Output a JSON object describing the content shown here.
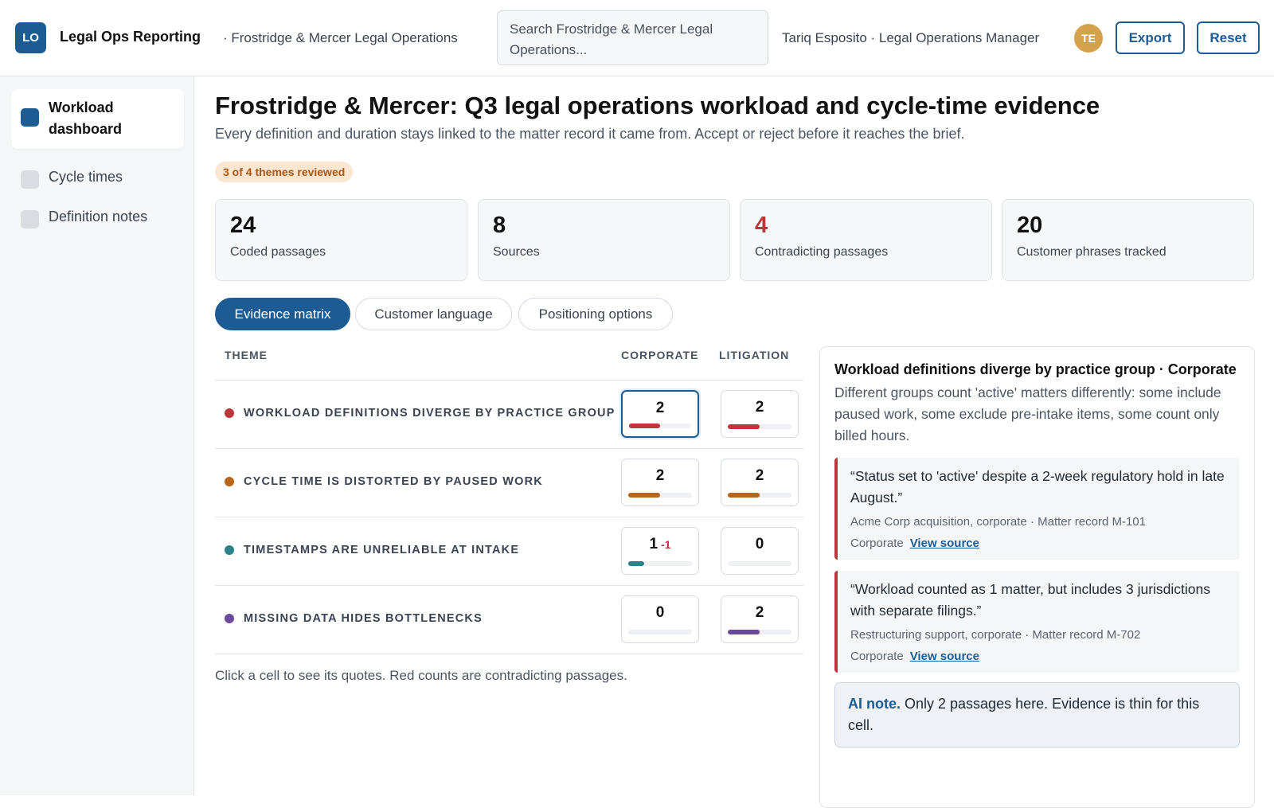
{
  "header": {
    "logo_text": "LO",
    "app_title": "Legal Ops Reporting",
    "org_name": "· Frostridge & Mercer Legal Operations",
    "search_placeholder": "Search Frostridge & Mercer Legal Operations...",
    "user": "Tariq Esposito · Legal Operations Manager",
    "avatar_initials": "TE",
    "export_label": "Export",
    "reset_label": "Reset"
  },
  "sidebar": {
    "items": [
      {
        "label": "Workload dashboard",
        "active": true
      },
      {
        "label": "Cycle times",
        "active": false
      },
      {
        "label": "Definition notes",
        "active": false
      }
    ]
  },
  "page": {
    "title": "Frostridge & Mercer: Q3 legal operations workload and cycle-time evidence",
    "subtitle": "Every definition and duration stays linked to the matter record it came from. Accept or reject before it reaches the brief.",
    "review_badge": "3 of 4 themes reviewed"
  },
  "stats": [
    {
      "value": "24",
      "label": "Coded passages"
    },
    {
      "value": "8",
      "label": "Sources"
    },
    {
      "value": "4",
      "label": "Contradicting passages",
      "highlight": "#c0343b"
    },
    {
      "value": "20",
      "label": "Customer phrases tracked"
    }
  ],
  "tabs": [
    {
      "label": "Evidence matrix",
      "active": true
    },
    {
      "label": "Customer language",
      "active": false
    },
    {
      "label": "Positioning options",
      "active": false
    }
  ],
  "matrix": {
    "headers": {
      "theme": "THEME",
      "corporate": "CORPORATE",
      "litigation": "LITIGATION"
    },
    "max_count": 4,
    "rows": [
      {
        "theme": "WORKLOAD DEFINITIONS DIVERGE BY PRACTICE GROUP",
        "color": "#c0343b",
        "corporate": {
          "count": "2",
          "delta": "",
          "level": 2,
          "selected": true
        },
        "litigation": {
          "count": "2",
          "delta": "",
          "level": 2
        }
      },
      {
        "theme": "CYCLE TIME IS DISTORTED BY PAUSED WORK",
        "color": "#b8651b",
        "corporate": {
          "count": "2",
          "delta": "",
          "level": 2
        },
        "litigation": {
          "count": "2",
          "delta": "",
          "level": 2
        }
      },
      {
        "theme": "TIMESTAMPS ARE UNRELIABLE AT INTAKE",
        "color": "#2a8289",
        "corporate": {
          "count": "1",
          "delta": "-1",
          "level": 1
        },
        "litigation": {
          "count": "0",
          "delta": "",
          "level": 0
        }
      },
      {
        "theme": "MISSING DATA HIDES BOTTLENECKS",
        "color": "#6b4a99",
        "corporate": {
          "count": "0",
          "delta": "",
          "level": 0
        },
        "litigation": {
          "count": "2",
          "delta": "",
          "level": 2
        }
      }
    ],
    "note": "Click a cell to see its quotes. Red counts are contradicting passages."
  },
  "panel": {
    "title": "Workload definitions diverge by practice group · Corporate",
    "description": "Different groups count 'active' matters differently: some include paused work, some exclude pre-intake items, some count only billed hours.",
    "quotes": [
      {
        "text": "“Status set to 'active' despite a 2-week regulatory hold in late August.”",
        "meta": "Acme Corp acquisition, corporate · Matter record M-101",
        "group": "Corporate",
        "link": "View source"
      },
      {
        "text": "“Workload counted as 1 matter, but includes 3 jurisdictions with separate filings.”",
        "meta": "Restructuring support, corporate · Matter record M-702",
        "group": "Corporate",
        "link": "View source"
      }
    ],
    "ai_note_label": "AI note.",
    "ai_note_text": " Only 2 passages here. Evidence is thin for this cell."
  }
}
